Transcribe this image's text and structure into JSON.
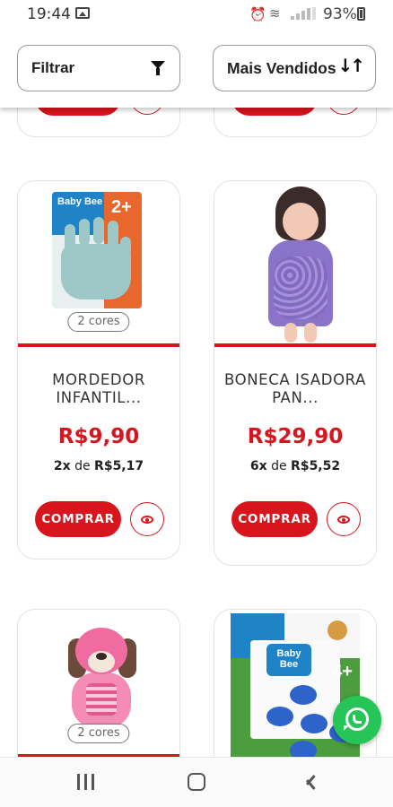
{
  "status_bar": {
    "time": "19:44",
    "battery": "93%"
  },
  "toolbar": {
    "filter_label": "Filtrar",
    "sort_label": "Mais Vendidos"
  },
  "products": [
    {
      "name": "MORDEDOR INFANTIL...",
      "colors_badge": "2 cores",
      "price": "R$9,90",
      "installments_count": "2x",
      "installments_mid": " de ",
      "installments_value": "R$5,17",
      "buy_label": "COMPRAR"
    },
    {
      "name": "BONECA ISADORA PAN...",
      "price": "R$29,90",
      "installments_count": "6x",
      "installments_mid": " de ",
      "installments_value": "R$5,52",
      "buy_label": "COMPRAR"
    },
    {
      "colors_badge": "2 cores"
    },
    {
      "package_brand": "Baby Bee"
    }
  ],
  "package_text": {
    "brand": "Baby Bee",
    "age": "2+",
    "age2": "4+"
  },
  "colors": {
    "accent_red": "#d8141c",
    "whatsapp_green": "#25c558"
  }
}
